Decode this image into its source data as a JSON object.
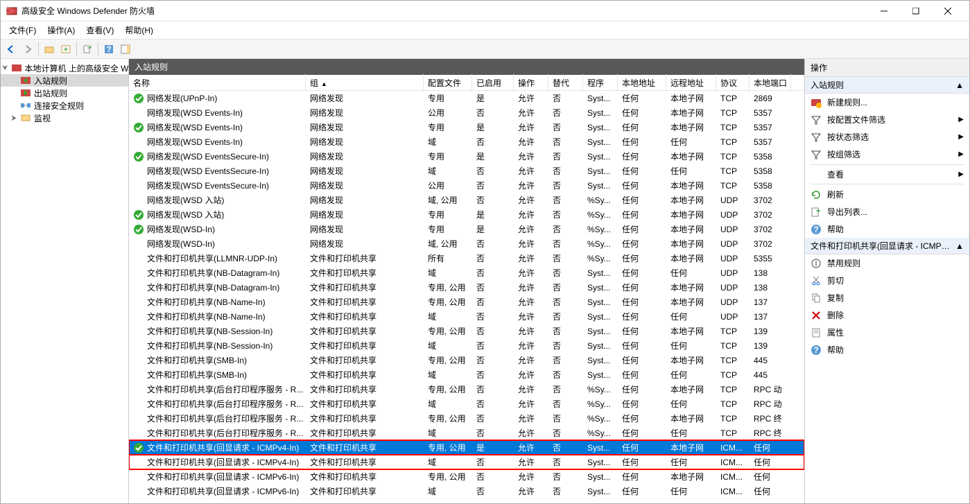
{
  "window_title": "高级安全 Windows Defender 防火墙",
  "menus": {
    "file": "文件(F)",
    "action": "操作(A)",
    "view": "查看(V)",
    "help": "帮助(H)"
  },
  "tree": {
    "root": "本地计算机 上的高级安全 Win",
    "inbound": "入站规则",
    "outbound": "出站规则",
    "connsec": "连接安全规则",
    "monitor": "监视"
  },
  "main_header": "入站规则",
  "columns": {
    "name": "名称",
    "group": "组",
    "profile": "配置文件",
    "enabled": "已启用",
    "action": "操作",
    "override": "替代",
    "program": "程序",
    "laddr": "本地地址",
    "raddr": "远程地址",
    "proto": "协议",
    "lport": "本地端口"
  },
  "rules": [
    {
      "on": true,
      "name": "网络发现(UPnP-In)",
      "group": "网络发现",
      "profile": "专用",
      "enabled": "是",
      "action": "允许",
      "override": "否",
      "program": "Syst...",
      "laddr": "任何",
      "raddr": "本地子网",
      "proto": "TCP",
      "lport": "2869"
    },
    {
      "on": false,
      "name": "网络发现(WSD Events-In)",
      "group": "网络发现",
      "profile": "公用",
      "enabled": "否",
      "action": "允许",
      "override": "否",
      "program": "Syst...",
      "laddr": "任何",
      "raddr": "本地子网",
      "proto": "TCP",
      "lport": "5357"
    },
    {
      "on": true,
      "name": "网络发现(WSD Events-In)",
      "group": "网络发现",
      "profile": "专用",
      "enabled": "是",
      "action": "允许",
      "override": "否",
      "program": "Syst...",
      "laddr": "任何",
      "raddr": "本地子网",
      "proto": "TCP",
      "lport": "5357"
    },
    {
      "on": false,
      "name": "网络发现(WSD Events-In)",
      "group": "网络发现",
      "profile": "域",
      "enabled": "否",
      "action": "允许",
      "override": "否",
      "program": "Syst...",
      "laddr": "任何",
      "raddr": "任何",
      "proto": "TCP",
      "lport": "5357"
    },
    {
      "on": true,
      "name": "网络发现(WSD EventsSecure-In)",
      "group": "网络发现",
      "profile": "专用",
      "enabled": "是",
      "action": "允许",
      "override": "否",
      "program": "Syst...",
      "laddr": "任何",
      "raddr": "本地子网",
      "proto": "TCP",
      "lport": "5358"
    },
    {
      "on": false,
      "name": "网络发现(WSD EventsSecure-In)",
      "group": "网络发现",
      "profile": "域",
      "enabled": "否",
      "action": "允许",
      "override": "否",
      "program": "Syst...",
      "laddr": "任何",
      "raddr": "任何",
      "proto": "TCP",
      "lport": "5358"
    },
    {
      "on": false,
      "name": "网络发现(WSD EventsSecure-In)",
      "group": "网络发现",
      "profile": "公用",
      "enabled": "否",
      "action": "允许",
      "override": "否",
      "program": "Syst...",
      "laddr": "任何",
      "raddr": "本地子网",
      "proto": "TCP",
      "lport": "5358"
    },
    {
      "on": false,
      "name": "网络发现(WSD 入站)",
      "group": "网络发现",
      "profile": "域, 公用",
      "enabled": "否",
      "action": "允许",
      "override": "否",
      "program": "%Sy...",
      "laddr": "任何",
      "raddr": "本地子网",
      "proto": "UDP",
      "lport": "3702"
    },
    {
      "on": true,
      "name": "网络发现(WSD 入站)",
      "group": "网络发现",
      "profile": "专用",
      "enabled": "是",
      "action": "允许",
      "override": "否",
      "program": "%Sy...",
      "laddr": "任何",
      "raddr": "本地子网",
      "proto": "UDP",
      "lport": "3702"
    },
    {
      "on": true,
      "name": "网络发现(WSD-In)",
      "group": "网络发现",
      "profile": "专用",
      "enabled": "是",
      "action": "允许",
      "override": "否",
      "program": "%Sy...",
      "laddr": "任何",
      "raddr": "本地子网",
      "proto": "UDP",
      "lport": "3702"
    },
    {
      "on": false,
      "name": "网络发现(WSD-In)",
      "group": "网络发现",
      "profile": "域, 公用",
      "enabled": "否",
      "action": "允许",
      "override": "否",
      "program": "%Sy...",
      "laddr": "任何",
      "raddr": "本地子网",
      "proto": "UDP",
      "lport": "3702"
    },
    {
      "on": false,
      "name": "文件和打印机共享(LLMNR-UDP-In)",
      "group": "文件和打印机共享",
      "profile": "所有",
      "enabled": "否",
      "action": "允许",
      "override": "否",
      "program": "%Sy...",
      "laddr": "任何",
      "raddr": "本地子网",
      "proto": "UDP",
      "lport": "5355"
    },
    {
      "on": false,
      "name": "文件和打印机共享(NB-Datagram-In)",
      "group": "文件和打印机共享",
      "profile": "域",
      "enabled": "否",
      "action": "允许",
      "override": "否",
      "program": "Syst...",
      "laddr": "任何",
      "raddr": "任何",
      "proto": "UDP",
      "lport": "138"
    },
    {
      "on": false,
      "name": "文件和打印机共享(NB-Datagram-In)",
      "group": "文件和打印机共享",
      "profile": "专用, 公用",
      "enabled": "否",
      "action": "允许",
      "override": "否",
      "program": "Syst...",
      "laddr": "任何",
      "raddr": "本地子网",
      "proto": "UDP",
      "lport": "138"
    },
    {
      "on": false,
      "name": "文件和打印机共享(NB-Name-In)",
      "group": "文件和打印机共享",
      "profile": "专用, 公用",
      "enabled": "否",
      "action": "允许",
      "override": "否",
      "program": "Syst...",
      "laddr": "任何",
      "raddr": "本地子网",
      "proto": "UDP",
      "lport": "137"
    },
    {
      "on": false,
      "name": "文件和打印机共享(NB-Name-In)",
      "group": "文件和打印机共享",
      "profile": "域",
      "enabled": "否",
      "action": "允许",
      "override": "否",
      "program": "Syst...",
      "laddr": "任何",
      "raddr": "任何",
      "proto": "UDP",
      "lport": "137"
    },
    {
      "on": false,
      "name": "文件和打印机共享(NB-Session-In)",
      "group": "文件和打印机共享",
      "profile": "专用, 公用",
      "enabled": "否",
      "action": "允许",
      "override": "否",
      "program": "Syst...",
      "laddr": "任何",
      "raddr": "本地子网",
      "proto": "TCP",
      "lport": "139"
    },
    {
      "on": false,
      "name": "文件和打印机共享(NB-Session-In)",
      "group": "文件和打印机共享",
      "profile": "域",
      "enabled": "否",
      "action": "允许",
      "override": "否",
      "program": "Syst...",
      "laddr": "任何",
      "raddr": "任何",
      "proto": "TCP",
      "lport": "139"
    },
    {
      "on": false,
      "name": "文件和打印机共享(SMB-In)",
      "group": "文件和打印机共享",
      "profile": "专用, 公用",
      "enabled": "否",
      "action": "允许",
      "override": "否",
      "program": "Syst...",
      "laddr": "任何",
      "raddr": "本地子网",
      "proto": "TCP",
      "lport": "445"
    },
    {
      "on": false,
      "name": "文件和打印机共享(SMB-In)",
      "group": "文件和打印机共享",
      "profile": "域",
      "enabled": "否",
      "action": "允许",
      "override": "否",
      "program": "Syst...",
      "laddr": "任何",
      "raddr": "任何",
      "proto": "TCP",
      "lport": "445"
    },
    {
      "on": false,
      "name": "文件和打印机共享(后台打印程序服务 - R...",
      "group": "文件和打印机共享",
      "profile": "专用, 公用",
      "enabled": "否",
      "action": "允许",
      "override": "否",
      "program": "%Sy...",
      "laddr": "任何",
      "raddr": "本地子网",
      "proto": "TCP",
      "lport": "RPC 动"
    },
    {
      "on": false,
      "name": "文件和打印机共享(后台打印程序服务 - R...",
      "group": "文件和打印机共享",
      "profile": "域",
      "enabled": "否",
      "action": "允许",
      "override": "否",
      "program": "%Sy...",
      "laddr": "任何",
      "raddr": "任何",
      "proto": "TCP",
      "lport": "RPC 动"
    },
    {
      "on": false,
      "name": "文件和打印机共享(后台打印程序服务 - R...",
      "group": "文件和打印机共享",
      "profile": "专用, 公用",
      "enabled": "否",
      "action": "允许",
      "override": "否",
      "program": "%Sy...",
      "laddr": "任何",
      "raddr": "本地子网",
      "proto": "TCP",
      "lport": "RPC 终"
    },
    {
      "on": false,
      "name": "文件和打印机共享(后台打印程序服务 - R...",
      "group": "文件和打印机共享",
      "profile": "域",
      "enabled": "否",
      "action": "允许",
      "override": "否",
      "program": "%Sy...",
      "laddr": "任何",
      "raddr": "任何",
      "proto": "TCP",
      "lport": "RPC 终"
    },
    {
      "on": true,
      "name": "文件和打印机共享(回显请求 - ICMPv4-In)",
      "group": "文件和打印机共享",
      "profile": "专用, 公用",
      "enabled": "是",
      "action": "允许",
      "override": "否",
      "program": "Syst...",
      "laddr": "任何",
      "raddr": "本地子网",
      "proto": "ICM...",
      "lport": "任何",
      "selected": true,
      "hl": true
    },
    {
      "on": false,
      "name": "文件和打印机共享(回显请求 - ICMPv4-In)",
      "group": "文件和打印机共享",
      "profile": "域",
      "enabled": "否",
      "action": "允许",
      "override": "否",
      "program": "Syst...",
      "laddr": "任何",
      "raddr": "任何",
      "proto": "ICM...",
      "lport": "任何",
      "hl": true
    },
    {
      "on": false,
      "name": "文件和打印机共享(回显请求 - ICMPv6-In)",
      "group": "文件和打印机共享",
      "profile": "专用, 公用",
      "enabled": "否",
      "action": "允许",
      "override": "否",
      "program": "Syst...",
      "laddr": "任何",
      "raddr": "本地子网",
      "proto": "ICM...",
      "lport": "任何"
    },
    {
      "on": false,
      "name": "文件和打印机共享(回显请求 - ICMPv6-In)",
      "group": "文件和打印机共享",
      "profile": "域",
      "enabled": "否",
      "action": "允许",
      "override": "否",
      "program": "Syst...",
      "laddr": "任何",
      "raddr": "任何",
      "proto": "ICM...",
      "lport": "任何"
    }
  ],
  "actions_header": "操作",
  "actions": {
    "section1": "入站规则",
    "new_rule": "新建规则...",
    "filter_profile": "按配置文件筛选",
    "filter_state": "按状态筛选",
    "filter_group": "按组筛选",
    "view": "查看",
    "refresh": "刷新",
    "export": "导出列表...",
    "help1": "帮助",
    "section2": "文件和打印机共享(回显请求 - ICMPv...",
    "disable": "禁用规则",
    "cut": "剪切",
    "copy": "复制",
    "delete": "删除",
    "properties": "属性",
    "help2": "帮助"
  }
}
